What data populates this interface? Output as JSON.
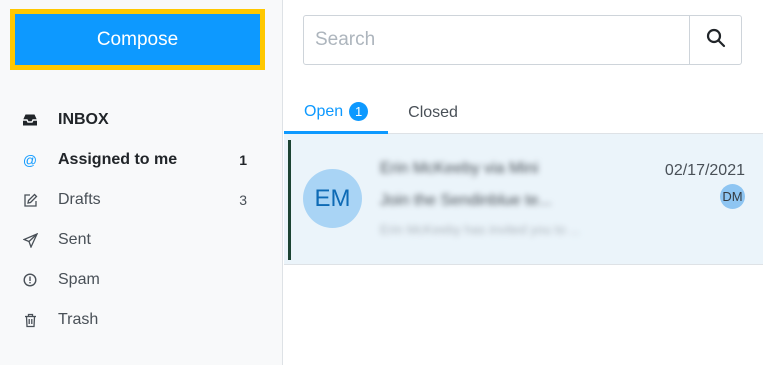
{
  "sidebar": {
    "compose_label": "Compose",
    "items": [
      {
        "label": "INBOX",
        "icon": "inbox-icon",
        "count": ""
      },
      {
        "label": "Assigned to me",
        "icon": "at-icon",
        "count": "1"
      },
      {
        "label": "Drafts",
        "icon": "edit-icon",
        "count": "3"
      },
      {
        "label": "Sent",
        "icon": "send-icon",
        "count": ""
      },
      {
        "label": "Spam",
        "icon": "alert-icon",
        "count": ""
      },
      {
        "label": "Trash",
        "icon": "trash-icon",
        "count": ""
      }
    ]
  },
  "search": {
    "placeholder": "Search",
    "value": "",
    "icon": "search-icon"
  },
  "tabs": [
    {
      "label": "Open",
      "badge": "1"
    },
    {
      "label": "Closed"
    }
  ],
  "conversations": [
    {
      "avatar": "EM",
      "from": "Erin McKeeby via Mini",
      "subject": "Join the Sendinblue te...",
      "preview": "Erin McKeeby has invited you to ...",
      "date": "02/17/2021",
      "assignee": "DM"
    }
  ],
  "colors": {
    "accent": "#0d99ff",
    "highlight": "#ffc800",
    "selected_row": "#ebf4fa"
  }
}
